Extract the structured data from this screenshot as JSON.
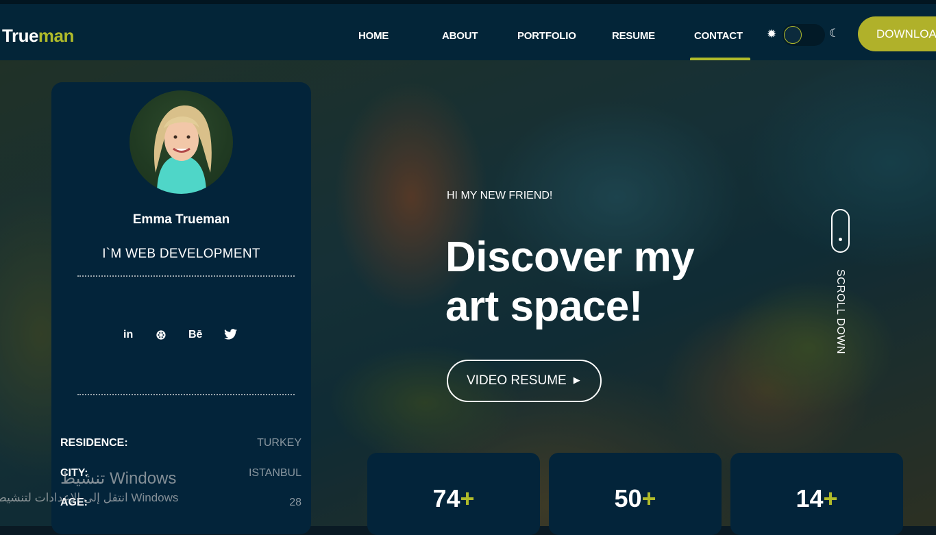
{
  "brand": {
    "part1": "True",
    "part2": "man",
    "accent_color": "#b0bb2a"
  },
  "nav": {
    "items": [
      {
        "label": "HOME"
      },
      {
        "label": "ABOUT"
      },
      {
        "label": "PORTFOLIO"
      },
      {
        "label": "RESUME"
      },
      {
        "label": "CONTACT",
        "active": true
      }
    ],
    "theme_toggle": {
      "sun_icon": "sun-icon",
      "moon_icon": "moon-icon"
    },
    "download_label": "DOWNLOAD"
  },
  "profile": {
    "name": "Emma Trueman",
    "role": "I`M WEB DEVELOPMENT",
    "socials": [
      {
        "icon": "linkedin-icon",
        "glyph": "in"
      },
      {
        "icon": "dribbble-icon",
        "glyph": "⊛"
      },
      {
        "icon": "behance-icon",
        "glyph": "Bē"
      },
      {
        "icon": "twitter-icon",
        "glyph": "🐦"
      }
    ],
    "info": [
      {
        "key": "RESIDENCE:",
        "value": "TURKEY"
      },
      {
        "key": "CITY:",
        "value": "ISTANBUL"
      },
      {
        "key": "AGE:",
        "value": "28"
      }
    ]
  },
  "hero": {
    "greeting": "HI MY NEW FRIEND!",
    "headline_line1": "Discover my",
    "headline_line2": "art space!",
    "video_button": "VIDEO RESUME",
    "play_icon": "play-icon",
    "scroll_label": "SCROLL DOWN"
  },
  "stats": [
    {
      "number": "74",
      "suffix": "+"
    },
    {
      "number": "50",
      "suffix": "+"
    },
    {
      "number": "14",
      "suffix": "+"
    }
  ],
  "watermark": {
    "line1": "تنشيط Windows",
    "line2": "انتقل إلى الإعدادات لتنشيط Windows"
  }
}
